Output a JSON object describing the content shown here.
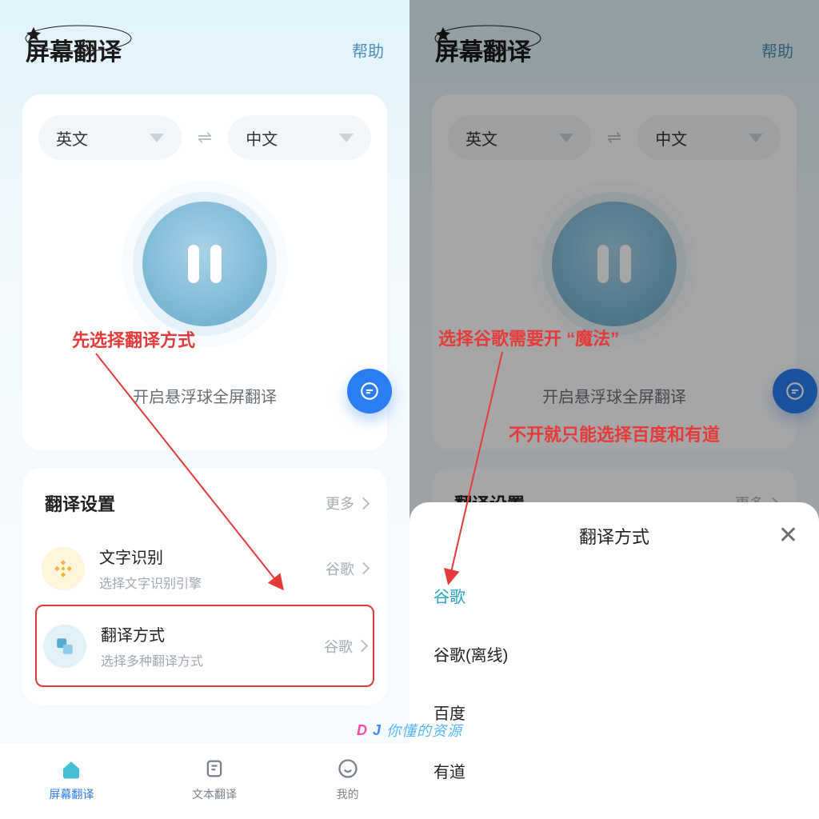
{
  "header": {
    "title": "屏幕翻译",
    "help": "帮助"
  },
  "lang": {
    "from": "英文",
    "to": "中文"
  },
  "main": {
    "hint": "开启悬浮球全屏翻译"
  },
  "settings": {
    "heading": "翻译设置",
    "more": "更多",
    "rows": [
      {
        "title": "文字识别",
        "sub": "选择文字识别引擎",
        "value": "谷歌"
      },
      {
        "title": "翻译方式",
        "sub": "选择多种翻译方式",
        "value": "谷歌"
      }
    ]
  },
  "nav": {
    "items": [
      "屏幕翻译",
      "文本翻译",
      "我的"
    ]
  },
  "annotations": {
    "left": "先选择翻译方式",
    "right1": "选择谷歌需要开 “魔法”",
    "right2": "不开就只能选择百度和有道"
  },
  "sheet": {
    "title": "翻译方式",
    "options": [
      "谷歌",
      "谷歌(离线)",
      "百度",
      "有道"
    ]
  },
  "watermark": "你懂的资源"
}
